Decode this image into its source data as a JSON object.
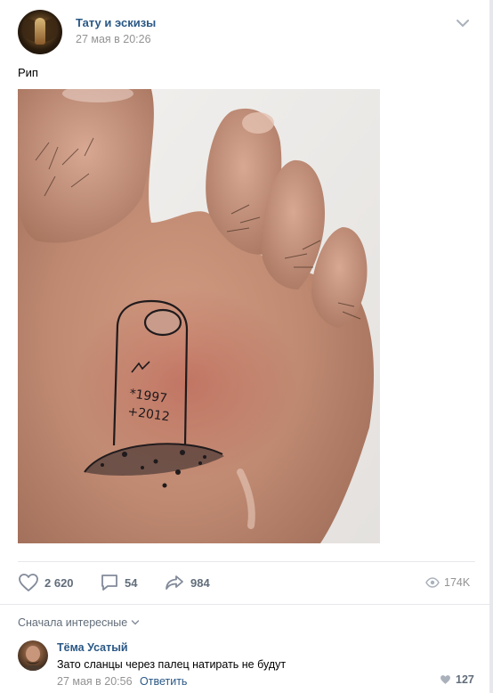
{
  "post": {
    "group_name": "Тату и эскизы",
    "date": "27 мая в 20:26",
    "text": "Рип",
    "photo_tattoo_text": {
      "born": "*1997",
      "died": "+2012"
    }
  },
  "actions": {
    "likes": "2 620",
    "comments": "54",
    "shares": "984",
    "views": "174K"
  },
  "comments": {
    "sort_label": "Сначала интересные",
    "items": [
      {
        "author": "Тёма Усатый",
        "text": "Зато сланцы через палец натирать не будут",
        "date": "27 мая в 20:56",
        "reply_label": "Ответить",
        "likes": "127"
      }
    ]
  },
  "icons": {
    "chevron": "chevron-down-icon",
    "like": "heart-icon",
    "comment": "comment-icon",
    "share": "share-icon",
    "views": "eye-icon"
  },
  "colors": {
    "link": "#2a5885",
    "secondary": "#939393",
    "action": "#626d7a",
    "divider": "#e7e8ec"
  }
}
